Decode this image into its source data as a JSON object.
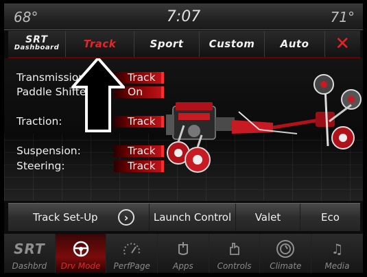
{
  "status": {
    "outside_temp": "68°",
    "time": "7:07",
    "inside_temp": "71°"
  },
  "tabs": {
    "srt_logo": "SRT",
    "srt_sub": "Dashboard",
    "track": "Track",
    "sport": "Sport",
    "custom": "Custom",
    "auto": "Auto",
    "close": "✕"
  },
  "settings": [
    {
      "label": "Transmission:",
      "value": "Track"
    },
    {
      "label": "Paddle Shifters:",
      "value": "On"
    },
    {
      "label": "Traction:",
      "value": "Track"
    },
    {
      "label": "Suspension:",
      "value": "Track"
    },
    {
      "label": "Steering:",
      "value": "Track"
    }
  ],
  "buttons": {
    "track_setup": "Track Set-Up",
    "launch_control": "Launch Control",
    "valet": "Valet",
    "eco": "Eco"
  },
  "nav": [
    {
      "label": "Dashbrd",
      "icon": "srt-logo-icon",
      "glyph": "SRT"
    },
    {
      "label": "Drv Mode",
      "icon": "steering-wheel-icon",
      "glyph": ""
    },
    {
      "label": "PerfPage",
      "icon": "gauge-icon",
      "glyph": ""
    },
    {
      "label": "Apps",
      "icon": "apps-icon",
      "glyph": ""
    },
    {
      "label": "Controls",
      "icon": "hand-controls-icon",
      "glyph": ""
    },
    {
      "label": "Climate",
      "icon": "climate-icon",
      "glyph": ""
    },
    {
      "label": "Media",
      "icon": "music-note-icon",
      "glyph": "♫"
    }
  ],
  "colors": {
    "accent": "#e3262a",
    "value_bar": "#c2141b",
    "background": "#0c0c0c"
  }
}
